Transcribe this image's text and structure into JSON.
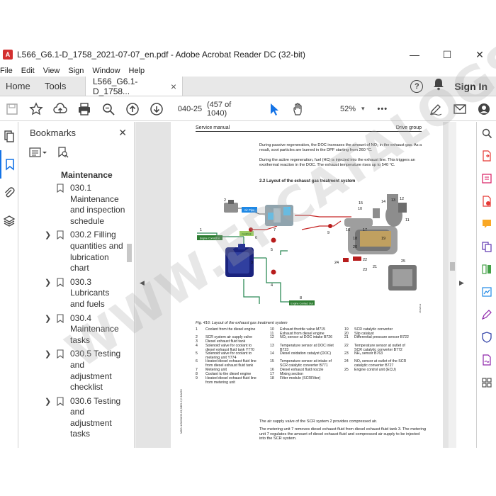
{
  "window": {
    "title": "L566_G6.1-D_1758_2021-07-07_en.pdf - Adobe Acrobat Reader DC (32-bit)",
    "app_icon_glyph": "A",
    "minimize": "—",
    "maximize": "☐",
    "close": "✕"
  },
  "menu": [
    "File",
    "Edit",
    "View",
    "Sign",
    "Window",
    "Help"
  ],
  "tabs": {
    "home": "Home",
    "tools": "Tools",
    "document": "L566_G6.1-D_1758...",
    "document_close": "×",
    "help": "?",
    "sign_in": "Sign In"
  },
  "toolbar": {
    "page_value": "040-25",
    "page_count": "(457 of 1040)",
    "zoom": "52%",
    "zoom_caret": "▾",
    "more": "•••"
  },
  "bookmarks": {
    "title": "Bookmarks",
    "close": "✕",
    "section": "Maintenance",
    "items": [
      {
        "label": "030.1 Maintenance and inspection schedule",
        "expandable": false
      },
      {
        "label": "030.2 Filling quantities and lubrication chart",
        "expandable": true
      },
      {
        "label": "030.3 Lubricants and fuels",
        "expandable": true
      },
      {
        "label": "030.4 Maintenance tasks",
        "expandable": true
      },
      {
        "label": "030.5 Testing and adjustment checklist",
        "expandable": true
      },
      {
        "label": "030.6 Testing and adjustment tasks",
        "expandable": true
      }
    ],
    "chevron": "❯"
  },
  "page": {
    "header_left": "Service manual",
    "header_right": "Drive group",
    "para1": "During passive regeneration, the DOC increases the amount of NO₂ in the exhaust gas. As a result, soot particles are burned in the DPF starting from 260 °C.",
    "para2": "During the active regeneration, fuel (HC) is injected into the exhaust line. This triggers an exothermal reaction in the DOC. The exhaust temperature rises up to 540 °C.",
    "heading": "2.2 Layout of the exhaust gas treatment system",
    "caption": "Fig. 416: Layout of the exhaust gas treatment system",
    "para3": "The air supply valve of the SCR system 2 provides compressed air.",
    "para4": "The metering unit 7 removes diesel exhaust fluid from diesel exhaust fluid tank 3. The metering unit 7 regulates the amount of diesel exhaust fluid and compressed air supply to be injected into the SCR system.",
    "side_label": "MBS-1/30/28/2103,MBS-2,2.3/A/56",
    "diagram_labels": {
      "air_pipe": "Air Pipe",
      "engine_contact_in": "Engine Contact In",
      "engine_contact_out": "Engine Contact Out",
      "gnd": "Gnd/Dstr",
      "fig_id": "L566/01/2",
      "n1": "1",
      "n2": "2",
      "n3": "3",
      "n4": "4",
      "n5": "5",
      "n6": "6",
      "n7": "7",
      "n8": "8",
      "n9": "9",
      "n10": "10",
      "n11": "11",
      "n12": "12",
      "n13": "13",
      "n14": "14",
      "n15": "15",
      "n16": "16",
      "n17": "17",
      "n18": "18",
      "n19": "19",
      "n20": "20",
      "n21": "21",
      "n22": "22",
      "n23": "23",
      "n24": "24",
      "n25": "25"
    },
    "legend": [
      {
        "n": "1",
        "t": "Coolant from the diesel engine"
      },
      {
        "n": "2",
        "t": "SCR system air supply valve"
      },
      {
        "n": "3",
        "t": "Diesel exhaust fluid tank"
      },
      {
        "n": "4",
        "t": "Solenoid valve for coolant to diesel exhaust fluid tank Y770"
      },
      {
        "n": "5",
        "t": "Solenoid valve for coolant to metering unit Y774"
      },
      {
        "n": "6",
        "t": "Heated diesel exhaust fluid line from diesel exhaust fluid tank"
      },
      {
        "n": "7",
        "t": "Metering unit"
      },
      {
        "n": "8",
        "t": "Coolant to the diesel engine"
      },
      {
        "n": "9",
        "t": "Heated diesel exhaust fluid line from metering unit"
      },
      {
        "n": "10",
        "t": "Exhaust throttle valve M715"
      },
      {
        "n": "11",
        "t": "Exhaust from diesel engine"
      },
      {
        "n": "12",
        "t": "NOₓ sensor at DOC intake B726"
      },
      {
        "n": "13",
        "t": "Temperature sensor at DOC inlet B723"
      },
      {
        "n": "14",
        "t": "Diesel oxidation catalyst (DOC)"
      },
      {
        "n": "15",
        "t": "Temperature sensor at intake of SCR catalytic converter B771"
      },
      {
        "n": "16",
        "t": "Diesel exhaust fluid nozzle"
      },
      {
        "n": "17",
        "t": "Mixing section"
      },
      {
        "n": "18",
        "t": "Filter module (SCRFilter)"
      },
      {
        "n": "19",
        "t": "SCR catalytic converter"
      },
      {
        "n": "20",
        "t": "Slip catalyst"
      },
      {
        "n": "21",
        "t": "Differential pressure sensor B722"
      },
      {
        "n": "22",
        "t": "Temperature sensor at outlet of SCR catalytic converter B772"
      },
      {
        "n": "23",
        "t": "NH₃ sensor B763"
      },
      {
        "n": "24",
        "t": "NOₓ sensor at outlet of the SCR catalytic converter B727"
      },
      {
        "n": "25",
        "t": "Engine control unit (ECU)"
      }
    ]
  },
  "watermark": "WWW.EPCATALOGS.COM",
  "colors": {
    "accent": "#1473e6",
    "tab_bar": "#e8e8e8",
    "doc_bg": "#e4e4e4",
    "coolant_line": "#2e8b57",
    "fluid_line": "#c62828",
    "tank_blue": "#1a237e"
  }
}
